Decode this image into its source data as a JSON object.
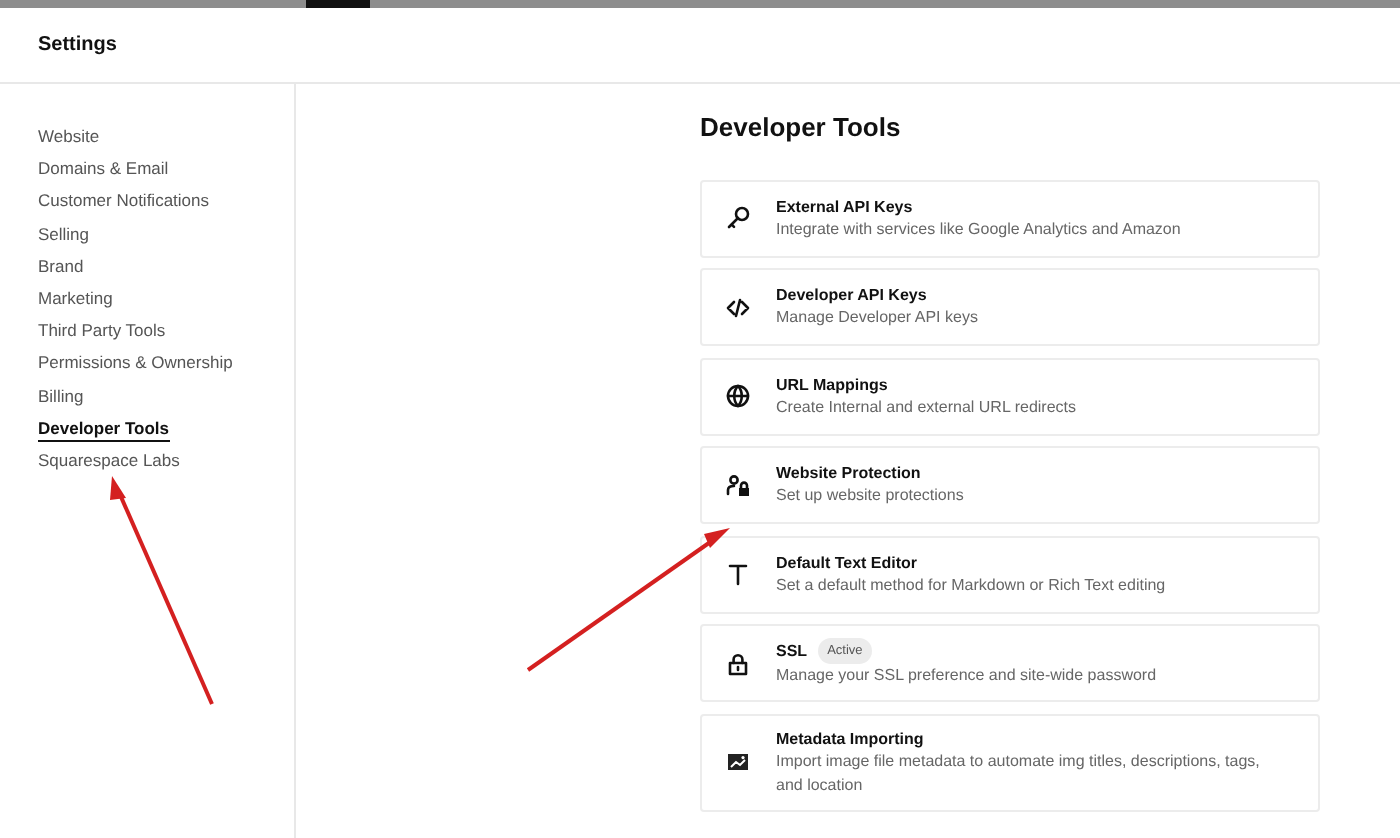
{
  "header": {
    "title": "Settings"
  },
  "sidebar": {
    "items": [
      {
        "label": "Website",
        "selected": false
      },
      {
        "label": "Domains & Email",
        "selected": false
      },
      {
        "label": "Customer Notifications",
        "selected": false
      },
      {
        "label": "Selling",
        "selected": false
      },
      {
        "label": "Brand",
        "selected": false
      },
      {
        "label": "Marketing",
        "selected": false
      },
      {
        "label": "Third Party Tools",
        "selected": false
      },
      {
        "label": "Permissions & Ownership",
        "selected": false
      },
      {
        "label": "Billing",
        "selected": false
      },
      {
        "label": "Developer Tools",
        "selected": true
      },
      {
        "label": "Squarespace Labs",
        "selected": false
      }
    ]
  },
  "main": {
    "title": "Developer Tools",
    "tools": [
      {
        "kind": "key",
        "title": "External API Keys",
        "description": "Integrate with services like Google Analytics and Amazon"
      },
      {
        "kind": "code",
        "title": "Developer API Keys",
        "description": "Manage Developer API keys"
      },
      {
        "kind": "globe",
        "title": "URL Mappings",
        "description": "Create Internal and external URL redirects"
      },
      {
        "kind": "person-lock",
        "title": "Website Protection",
        "description": "Set up website protections"
      },
      {
        "kind": "text",
        "title": "Default Text Editor",
        "description": "Set a default method for Markdown or Rich Text editing"
      },
      {
        "kind": "lock",
        "title": "SSL",
        "badge": "Active",
        "description": "Manage your SSL preference and site-wide password"
      },
      {
        "kind": "image",
        "title": "Metadata Importing",
        "description": "Import image file metadata to automate img titles, descriptions, tags, and location"
      }
    ]
  }
}
